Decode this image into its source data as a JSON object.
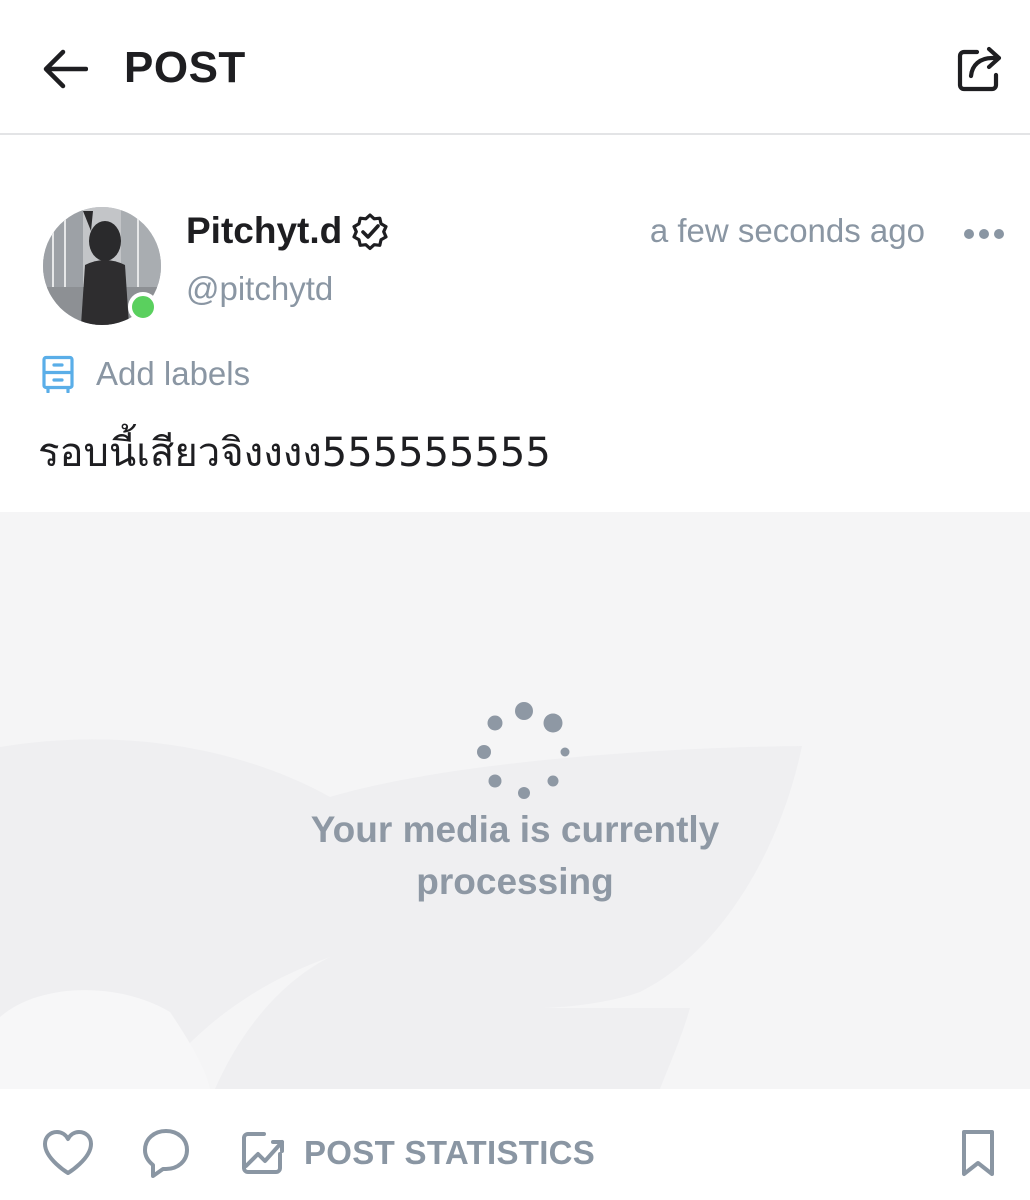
{
  "header": {
    "title": "POST",
    "back_icon": "arrow-left-icon",
    "share_icon": "share-icon"
  },
  "author": {
    "display_name": "Pitchyt.d",
    "username": "@pitchytd",
    "verified": true,
    "online": true,
    "timestamp": "a few seconds ago",
    "online_color": "#5ad05e"
  },
  "labels": {
    "text": "Add labels",
    "icon": "labels-icon",
    "accent": "#5aaee8"
  },
  "post": {
    "text": "รอบนี้เสียวจิงงงง555555555"
  },
  "media": {
    "status_text": "Your media is currently processing"
  },
  "footer": {
    "like_icon": "heart-icon",
    "comment_icon": "comment-icon",
    "stats_icon": "chart-icon",
    "stats_label": "POST STATISTICS",
    "bookmark_icon": "bookmark-icon"
  },
  "colors": {
    "text_primary": "#1e1e21",
    "text_secondary": "#8a96a3",
    "divider": "#e3e4e6"
  }
}
